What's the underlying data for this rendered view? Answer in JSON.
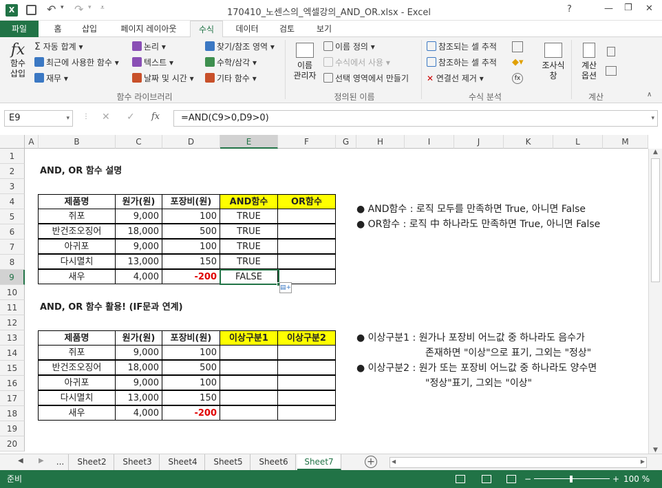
{
  "window": {
    "title": "170410_노센스의_엑셀강의_AND_OR.xlsx - Excel",
    "help": "?",
    "minimize": "—",
    "restore": "❐",
    "close": "✕"
  },
  "tabs": [
    "파일",
    "홈",
    "삽입",
    "페이지 레이아웃",
    "수식",
    "데이터",
    "검토",
    "보기"
  ],
  "ribbon": {
    "insert_function": "함수\n삽입",
    "autosum": "자동 합계",
    "recent": "최근에 사용한 함수",
    "finance": "재무",
    "logic": "논리",
    "text": "텍스트",
    "datetime": "날짜 및 시간",
    "lookup": "찾기/참조 영역",
    "math": "수학/삼각",
    "more": "기타 함수",
    "group1": "함수 라이브러리",
    "name_manager": "이름\n관리자",
    "define_name": "이름 정의",
    "use_in_formula": "수식에서 사용",
    "create_from_sel": "선택 영역에서 만들기",
    "group2": "정의된 이름",
    "trace_prec": "참조되는 셀 추적",
    "trace_dep": "참조하는 셀 추적",
    "remove_arrows": "연결선 제거",
    "group3": "수식 분석",
    "watch": "조사식\n창",
    "calc_options": "계산\n옵션",
    "group4": "계산"
  },
  "formula_bar": {
    "name_box": "E9",
    "fx": "fx",
    "formula": "=AND(C9>0,D9>0)"
  },
  "columns": [
    "A",
    "B",
    "C",
    "D",
    "E",
    "F",
    "G",
    "H",
    "I",
    "J",
    "K",
    "L",
    "M"
  ],
  "rows": [
    "1",
    "2",
    "3",
    "4",
    "5",
    "6",
    "7",
    "8",
    "9",
    "10",
    "11",
    "12",
    "13",
    "14",
    "15",
    "16",
    "17",
    "18",
    "19",
    "20"
  ],
  "section1": {
    "title": "AND, OR 함수 설명",
    "headers": [
      "제품명",
      "원가(원)",
      "포장비(원)",
      "AND함수",
      "OR함수"
    ],
    "rows": [
      [
        "쥐포",
        "9,000",
        "100",
        "TRUE",
        ""
      ],
      [
        "반건조오징어",
        "18,000",
        "500",
        "TRUE",
        ""
      ],
      [
        "아귀포",
        "9,000",
        "100",
        "TRUE",
        ""
      ],
      [
        "다시멸치",
        "13,000",
        "150",
        "TRUE",
        ""
      ],
      [
        "새우",
        "4,000",
        "-200",
        "FALSE",
        ""
      ]
    ]
  },
  "notes1": [
    "● AND함수 : 로직 모두를 만족하면 True, 아니면 False",
    "● OR함수 : 로직 中 하나라도 만족하면 True, 아니면 False"
  ],
  "section2": {
    "title": "AND, OR 함수 활용! (IF문과 연계)",
    "headers": [
      "제품명",
      "원가(원)",
      "포장비(원)",
      "이상구분1",
      "이상구분2"
    ],
    "rows": [
      [
        "쥐포",
        "9,000",
        "100",
        "",
        ""
      ],
      [
        "반건조오징어",
        "18,000",
        "500",
        "",
        ""
      ],
      [
        "아귀포",
        "9,000",
        "100",
        "",
        ""
      ],
      [
        "다시멸치",
        "13,000",
        "150",
        "",
        ""
      ],
      [
        "새우",
        "4,000",
        "-200",
        "",
        ""
      ]
    ]
  },
  "notes2": [
    "● 이상구분1 : 원가나 포장비 어느값 중 하나라도 음수가",
    "존재하면 \"이상\"으로 표기, 그외는 \"정상\"",
    "● 이상구분2 : 원가 또는 포장비 어느값 중 하나라도 양수면",
    "\"정상\"표기, 그외는 \"이상\""
  ],
  "sheets": [
    "...",
    "Sheet2",
    "Sheet3",
    "Sheet4",
    "Sheet5",
    "Sheet6",
    "Sheet7"
  ],
  "active_sheet": "Sheet7",
  "status": {
    "mode": "준비",
    "zoom": "100 %"
  },
  "colors": {
    "accent": "#217346",
    "highlight": "#ffff00",
    "negative": "#e00000"
  }
}
